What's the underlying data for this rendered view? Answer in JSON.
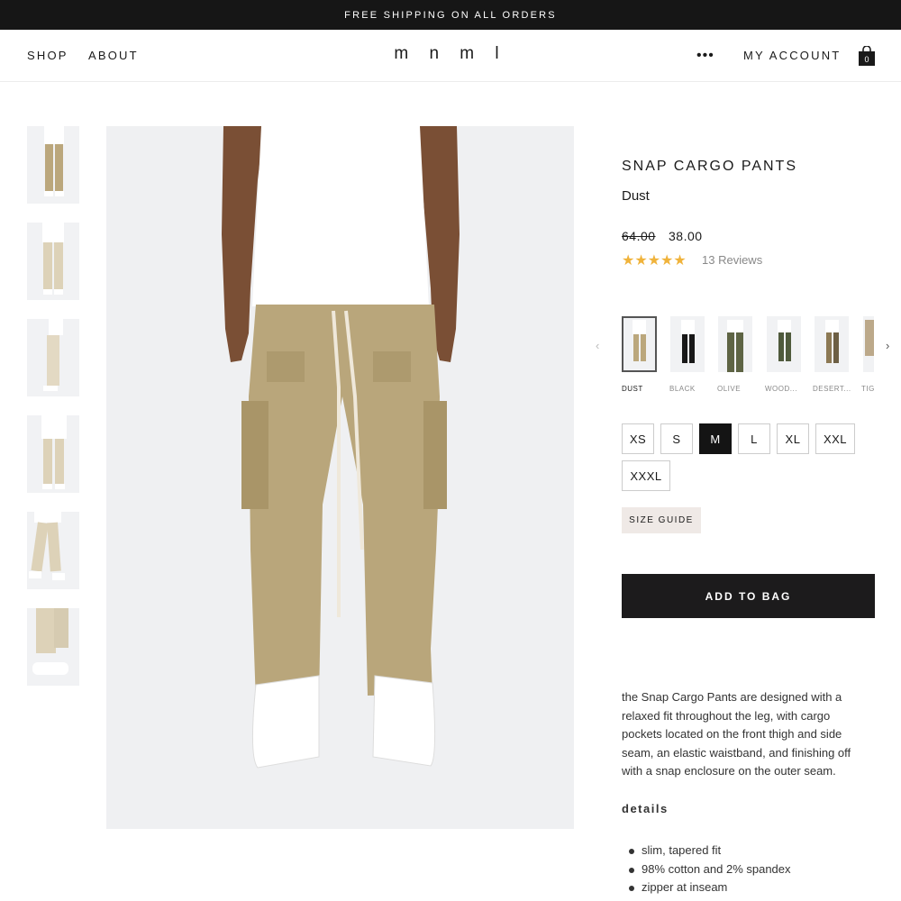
{
  "promo": {
    "text": "FREE SHIPPING ON ALL ORDERS"
  },
  "nav": {
    "shop": "SHOP",
    "about": "ABOUT",
    "logo": "m n m l",
    "more": "•••",
    "account": "MY ACCOUNT",
    "bag_count": "0"
  },
  "product": {
    "title": "SNAP CARGO PANTS",
    "color": "Dust",
    "price_old": "64.00",
    "price_new": "38.00",
    "stars": "★★★★★",
    "reviews": "13 Reviews",
    "colors": [
      "DUST",
      "BLACK",
      "OLIVE",
      "WOOD...",
      "DESERT...",
      "TIG"
    ],
    "sizes": [
      "XS",
      "S",
      "M",
      "L",
      "XL",
      "XXL",
      "XXXL"
    ],
    "selected_size": "M",
    "size_guide": "SIZE GUIDE",
    "add_to_bag": "ADD TO BAG",
    "description": "the Snap Cargo Pants are designed with a relaxed fit throughout the leg, with cargo pockets located on the front thigh and side seam, an elastic waistband, and finishing off with a snap enclosure on the outer seam.",
    "details_heading": "details",
    "details": [
      "slim, tapered fit",
      "98% cotton and 2% spandex",
      "zipper at inseam"
    ]
  },
  "colors": {
    "khaki": "#bba77c",
    "star": "#f0b33b",
    "dark": "#1c1b1c"
  }
}
